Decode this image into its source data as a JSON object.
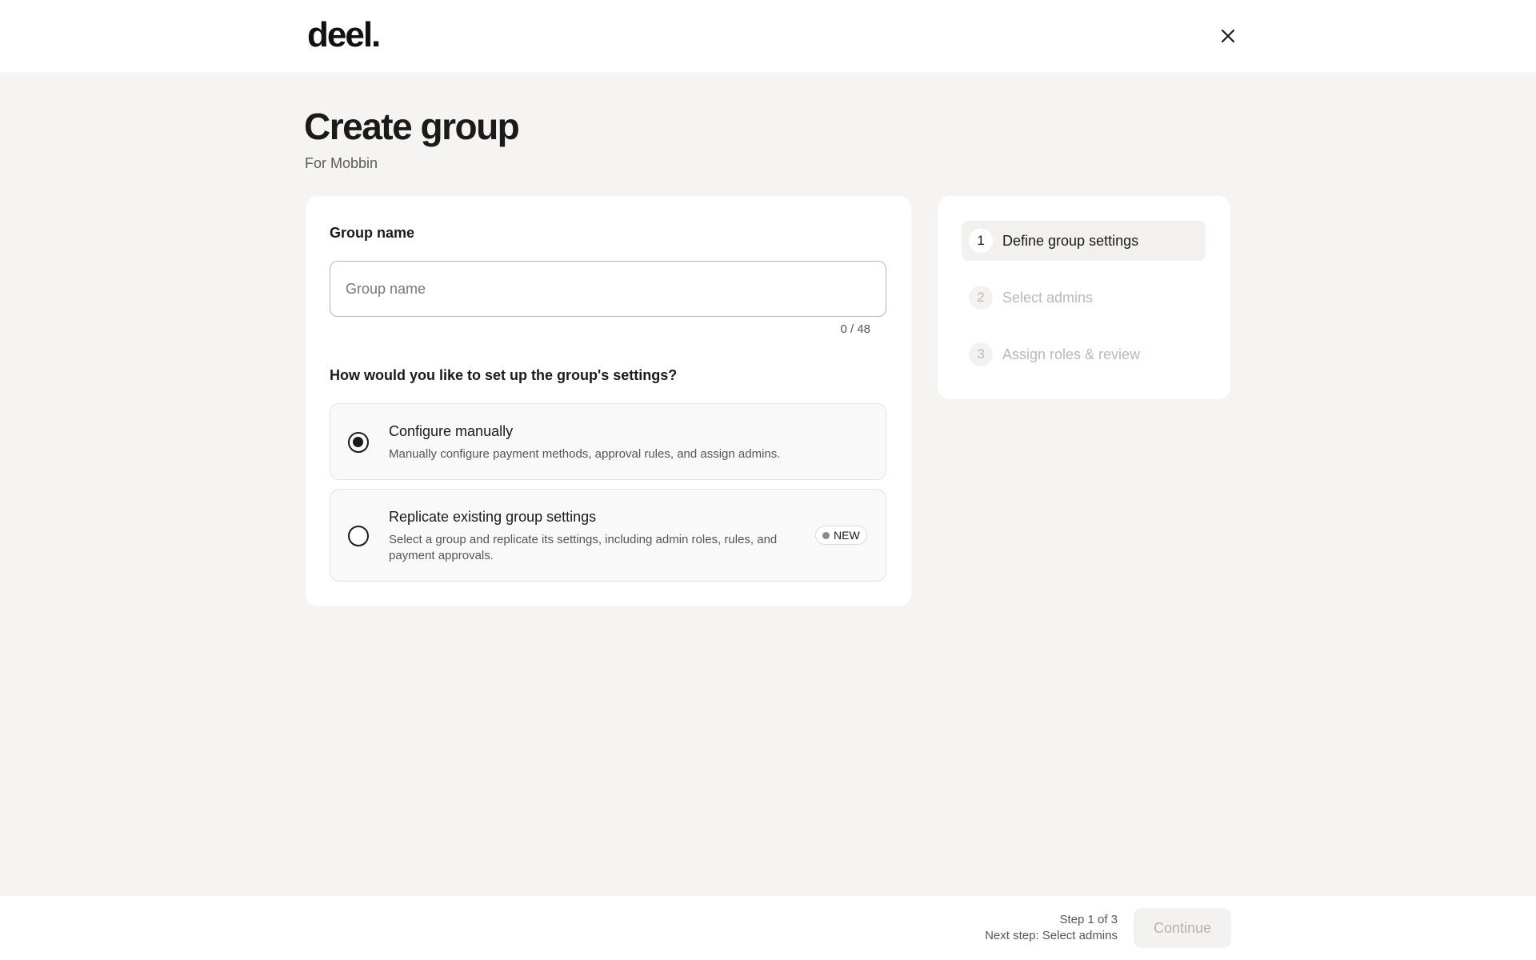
{
  "header": {
    "logo_text": "deel.",
    "close_icon": "close-icon"
  },
  "page": {
    "title": "Create group",
    "subtitle": "For Mobbin"
  },
  "form": {
    "group_name_label": "Group name",
    "group_name_value": "",
    "group_name_placeholder": "Group name",
    "char_count": "0 / 48",
    "settings_question": "How would you like to set up the group's settings?",
    "options": [
      {
        "title": "Configure manually",
        "description": "Manually configure payment methods, approval rules, and assign admins.",
        "selected": true
      },
      {
        "title": "Replicate existing group settings",
        "description": "Select a group and replicate its settings, including admin roles, rules, and payment approvals.",
        "selected": false,
        "badge": "NEW"
      }
    ]
  },
  "steps": [
    {
      "number": "1",
      "label": "Define group settings",
      "active": true
    },
    {
      "number": "2",
      "label": "Select admins",
      "active": false
    },
    {
      "number": "3",
      "label": "Assign roles & review",
      "active": false
    }
  ],
  "footer": {
    "step_text": "Step 1 of 3",
    "next_step_text": "Next step: Select admins",
    "continue_label": "Continue",
    "continue_enabled": false
  },
  "colors": {
    "page_background": "#f5f4f2",
    "card_background": "#ffffff",
    "text_primary": "#1a1a1a",
    "text_disabled": "#b8b8b8"
  }
}
